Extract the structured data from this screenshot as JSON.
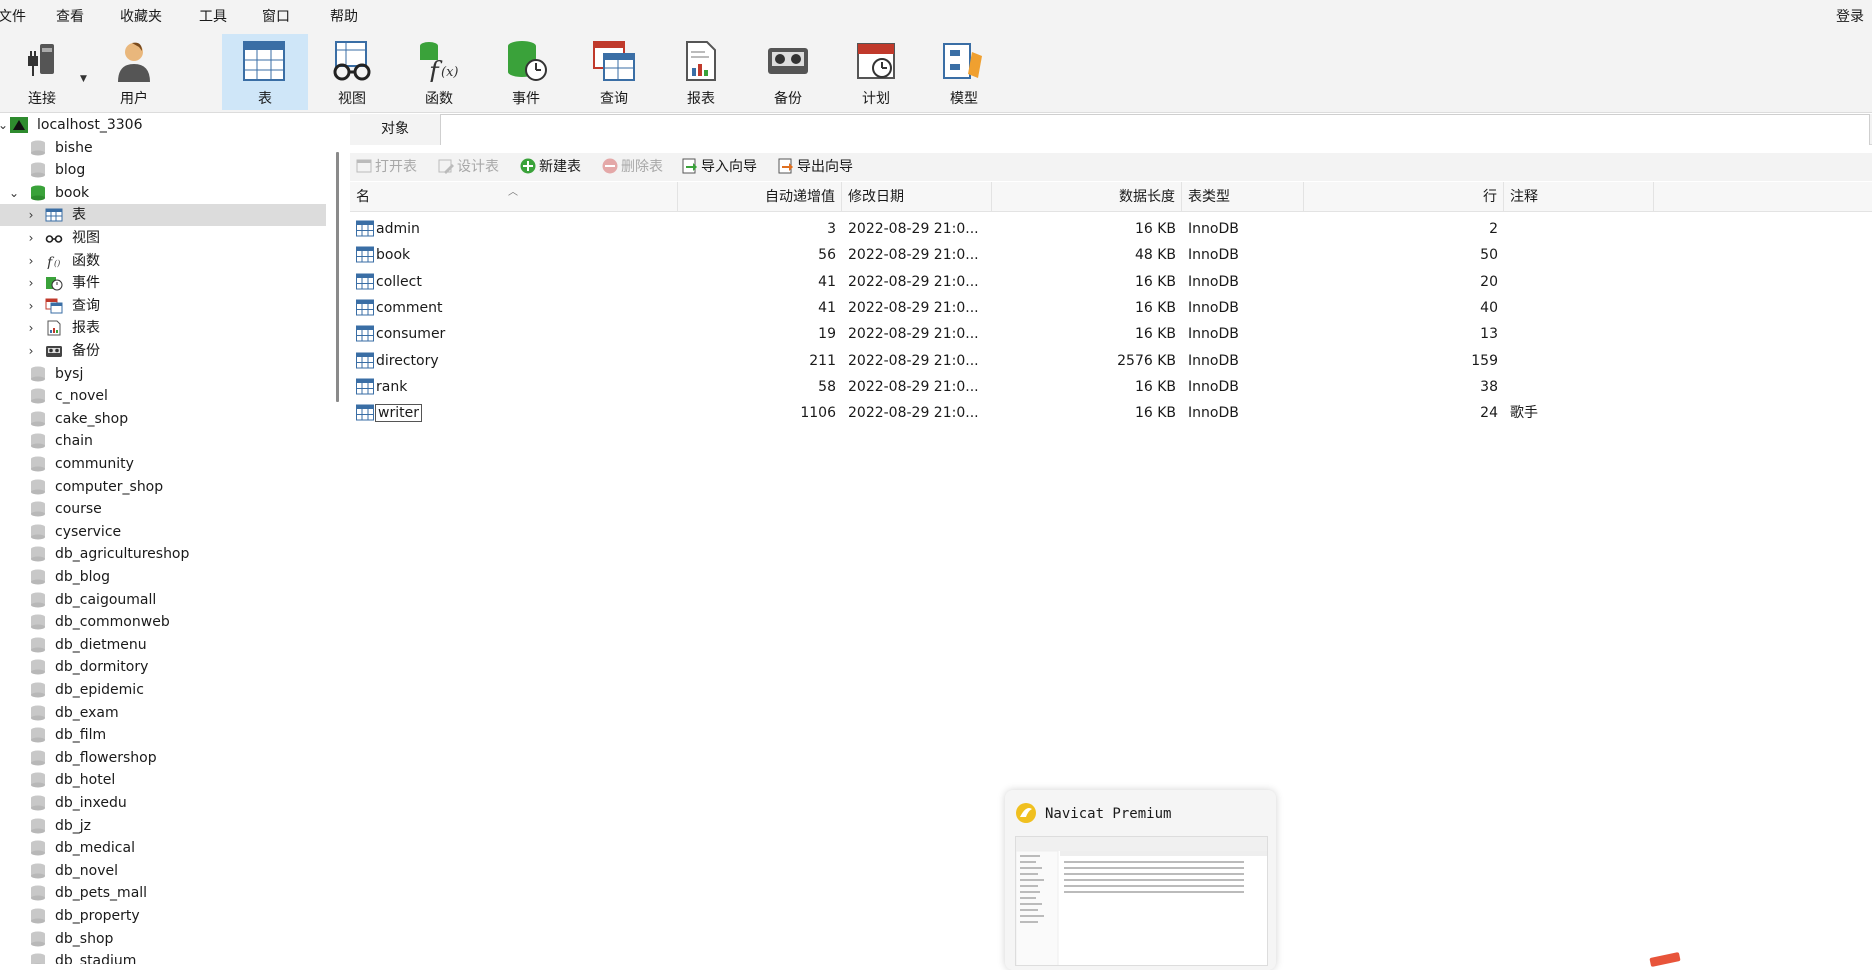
{
  "menubar": {
    "items": [
      "文件",
      "查看",
      "收藏夹",
      "工具",
      "窗口",
      "帮助"
    ],
    "login": "登录"
  },
  "toolbar": {
    "buttons": [
      {
        "label": "连接",
        "icon": "plug-icon"
      },
      {
        "label": "用户",
        "icon": "user-icon"
      },
      {
        "label": "表",
        "icon": "table-icon",
        "active": true
      },
      {
        "label": "视图",
        "icon": "glasses-icon"
      },
      {
        "label": "函数",
        "icon": "function-icon"
      },
      {
        "label": "事件",
        "icon": "event-clock-icon"
      },
      {
        "label": "查询",
        "icon": "query-icon"
      },
      {
        "label": "报表",
        "icon": "report-icon"
      },
      {
        "label": "备份",
        "icon": "backup-tape-icon"
      },
      {
        "label": "计划",
        "icon": "calendar-icon"
      },
      {
        "label": "模型",
        "icon": "model-icon"
      }
    ]
  },
  "sidebar": {
    "connection": "localhost_3306",
    "dbs_before": [
      "bishe",
      "blog"
    ],
    "open_db": "book",
    "open_db_children": [
      {
        "label": "表",
        "icon": "table-icon"
      },
      {
        "label": "视图",
        "icon": "glasses-icon"
      },
      {
        "label": "函数",
        "icon": "function-icon"
      },
      {
        "label": "事件",
        "icon": "event-clock-icon"
      },
      {
        "label": "查询",
        "icon": "query-icon"
      },
      {
        "label": "报表",
        "icon": "report-icon"
      },
      {
        "label": "备份",
        "icon": "backup-tape-icon"
      }
    ],
    "dbs_after": [
      "bysj",
      "c_novel",
      "cake_shop",
      "chain",
      "community",
      "computer_shop",
      "course",
      "cyservice",
      "db_agricultureshop",
      "db_blog",
      "db_caigoumall",
      "db_commonweb",
      "db_dietmenu",
      "db_dormitory",
      "db_epidemic",
      "db_exam",
      "db_film",
      "db_flowershop",
      "db_hotel",
      "db_inxedu",
      "db_jz",
      "db_medical",
      "db_novel",
      "db_pets_mall",
      "db_property",
      "db_shop",
      "db_stadium"
    ]
  },
  "tabs": {
    "objects": "对象"
  },
  "object_toolbar": {
    "open": "打开表",
    "design": "设计表",
    "new": "新建表",
    "delete": "删除表",
    "import": "导入向导",
    "export": "导出向导"
  },
  "grid": {
    "columns": [
      "名",
      "自动递增值",
      "修改日期",
      "数据长度",
      "表类型",
      "行",
      "注释"
    ],
    "rows": [
      {
        "name": "admin",
        "auto_inc": "3",
        "modified": "2022-08-29 21:0...",
        "size": "16 KB",
        "engine": "InnoDB",
        "rows": "2",
        "comment": ""
      },
      {
        "name": "book",
        "auto_inc": "56",
        "modified": "2022-08-29 21:0...",
        "size": "48 KB",
        "engine": "InnoDB",
        "rows": "50",
        "comment": ""
      },
      {
        "name": "collect",
        "auto_inc": "41",
        "modified": "2022-08-29 21:0...",
        "size": "16 KB",
        "engine": "InnoDB",
        "rows": "20",
        "comment": ""
      },
      {
        "name": "comment",
        "auto_inc": "41",
        "modified": "2022-08-29 21:0...",
        "size": "16 KB",
        "engine": "InnoDB",
        "rows": "40",
        "comment": ""
      },
      {
        "name": "consumer",
        "auto_inc": "19",
        "modified": "2022-08-29 21:0...",
        "size": "16 KB",
        "engine": "InnoDB",
        "rows": "13",
        "comment": ""
      },
      {
        "name": "directory",
        "auto_inc": "211",
        "modified": "2022-08-29 21:0...",
        "size": "2576 KB",
        "engine": "InnoDB",
        "rows": "159",
        "comment": ""
      },
      {
        "name": "rank",
        "auto_inc": "58",
        "modified": "2022-08-29 21:0...",
        "size": "16 KB",
        "engine": "InnoDB",
        "rows": "38",
        "comment": ""
      },
      {
        "name": "writer",
        "auto_inc": "1106",
        "modified": "2022-08-29 21:0...",
        "size": "16 KB",
        "engine": "InnoDB",
        "rows": "24",
        "comment": "歌手"
      }
    ]
  },
  "popup": {
    "title": "Navicat Premium"
  },
  "colors": {
    "accent": "#cfe6f8",
    "db_green": "#3aa23a",
    "selected_row": "#dcdcdc"
  }
}
